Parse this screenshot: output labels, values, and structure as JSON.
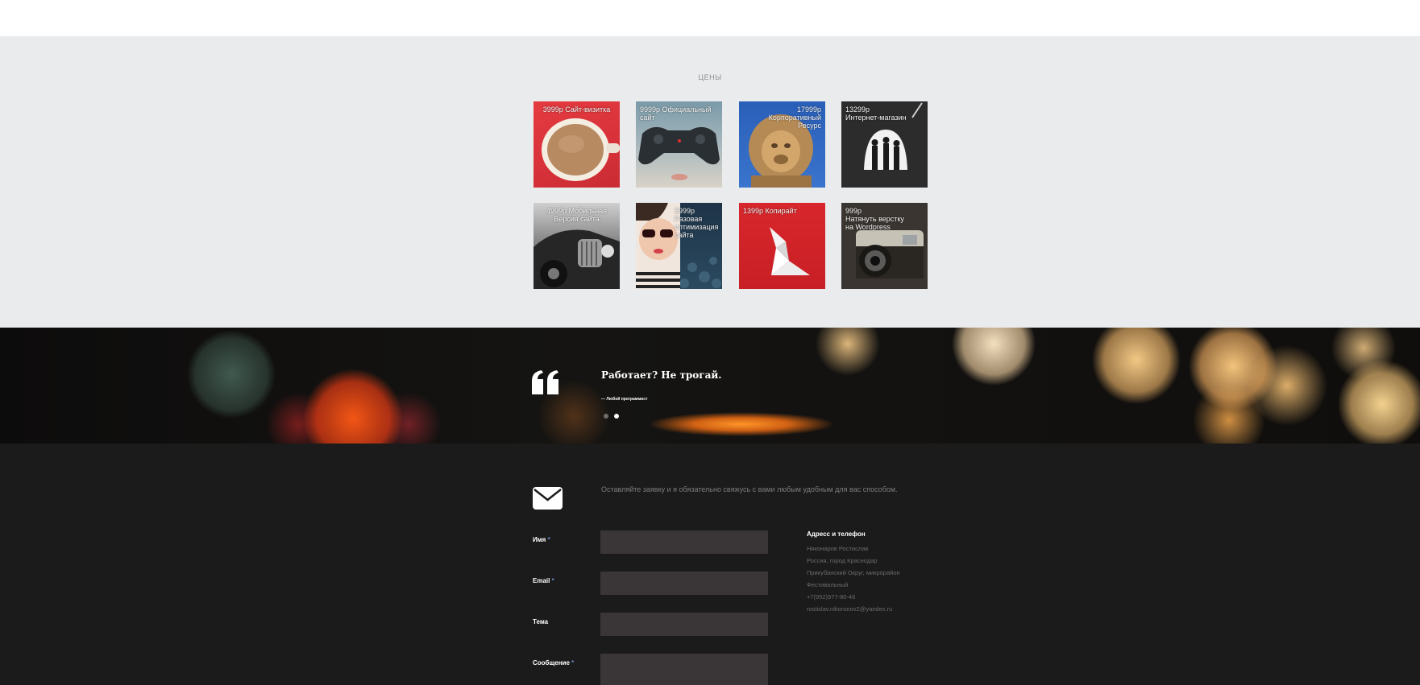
{
  "prices": {
    "title": "ЦЕНЫ",
    "items": [
      {
        "label": "3999р Сайт-визитка",
        "image": "coffee-cup-photo"
      },
      {
        "label": "9999р Официальный сайт",
        "image": "gamepad-photo"
      },
      {
        "label": "17999р Корпоративный\nРесурс",
        "image": "lion-statue-photo"
      },
      {
        "label": "13299р\nИнтернет-магазин",
        "image": "people-silhouettes-photo"
      },
      {
        "label": "4999р Мобильная\nВерсия сайта",
        "image": "vintage-car-photo"
      },
      {
        "label": "5999р\nРазовая\nоптимизация\nсайта",
        "image": "woman-sunglasses-photo"
      },
      {
        "label": "1399р Копирайт",
        "image": "origami-bird-photo"
      },
      {
        "label": "999р\nНатянуть верстку\nна Wordpress",
        "image": "retro-camera-photo"
      }
    ]
  },
  "quote": {
    "icon": "quote-icon",
    "text": "Работает? Не трогай.",
    "author": "— Любой программист",
    "pagination": {
      "count": 2,
      "active": 2
    }
  },
  "contact": {
    "icon": "envelope-icon",
    "intro": "Оставляйте заявку и я обязательно свяжусь с вами любым удобным для вас способом.",
    "fields": {
      "name": {
        "label": "Имя",
        "required": "*",
        "value": ""
      },
      "email": {
        "label": "Email",
        "required": "*",
        "value": ""
      },
      "subject": {
        "label": "Тема",
        "value": ""
      },
      "message": {
        "label": "Сообщение",
        "required": "*",
        "value": ""
      }
    },
    "address": {
      "title": "Адресс и телефон",
      "lines": [
        "Никонаров Ростислав",
        "Россия, город Краснодар",
        "Прикубанский Округ, микрорайон",
        "Фестивальный",
        "+7(952)977-80-46",
        "rostislav.nikonorov2@yandex.ru"
      ]
    }
  },
  "colors": {
    "prices_bg": "#eaebed",
    "contact_bg": "#1b1b1b",
    "field_bg": "#3a3637",
    "required_mark": "#6a8ec7"
  }
}
